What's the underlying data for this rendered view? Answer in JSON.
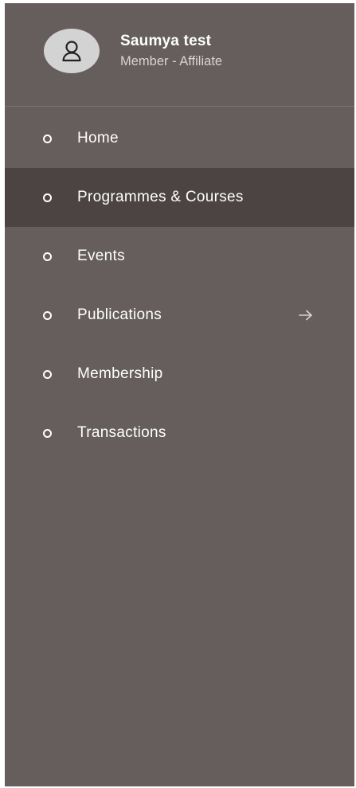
{
  "profile": {
    "avatar_icon": "user-icon",
    "name": "Saumya test",
    "role": "Member - Affiliate"
  },
  "menu": {
    "items": [
      {
        "label": "Home",
        "active": false
      },
      {
        "label": "Programmes & Courses",
        "active": true
      },
      {
        "label": "Events",
        "active": false
      },
      {
        "label": "Publications",
        "active": false,
        "has_submenu": true,
        "submenu_icon": "arrow-right-icon"
      },
      {
        "label": "Membership",
        "active": false
      },
      {
        "label": "Transactions",
        "active": false
      }
    ]
  },
  "colors": {
    "drawer_background": "#655e5c",
    "active_item_background": "#4b4442",
    "text": "#ffffff",
    "subtext": "#d8d3d1",
    "avatar_background": "#d3d3d3"
  }
}
